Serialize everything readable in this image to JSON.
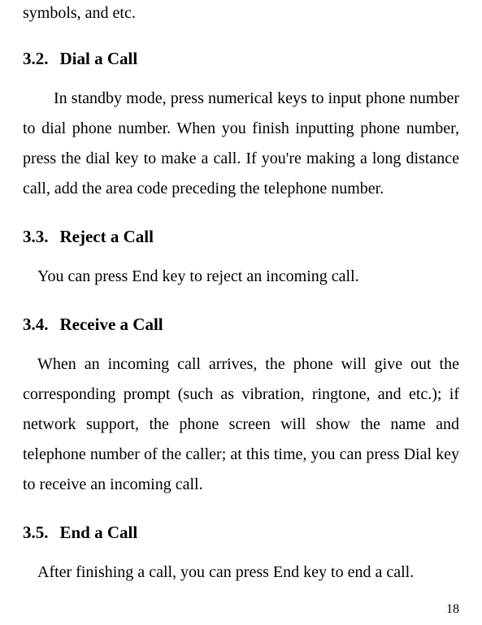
{
  "fragmentTop": "symbols, and etc.",
  "sections": {
    "s32": {
      "number": "3.2.",
      "title": "Dial a Call",
      "body": "In standby mode, press numerical keys to input phone number to dial phone number. When you finish inputting phone number, press the dial key to make a call. If you're making a long distance call, add the area code preceding the telephone number."
    },
    "s33": {
      "number": "3.3.",
      "title": "Reject a Call",
      "body": "You can press End key to reject an incoming call."
    },
    "s34": {
      "number": "3.4.",
      "title": "Receive a Call",
      "body": "When an incoming call arrives, the phone will give out the corresponding prompt (such as vibration, ringtone, and etc.); if network support, the phone screen will show the name and telephone number of the caller; at this time, you can press Dial key to receive an incoming call."
    },
    "s35": {
      "number": "3.5.",
      "title": "End a Call",
      "body": "After finishing a call, you can press End key to end a call."
    }
  },
  "pageNumber": "18"
}
